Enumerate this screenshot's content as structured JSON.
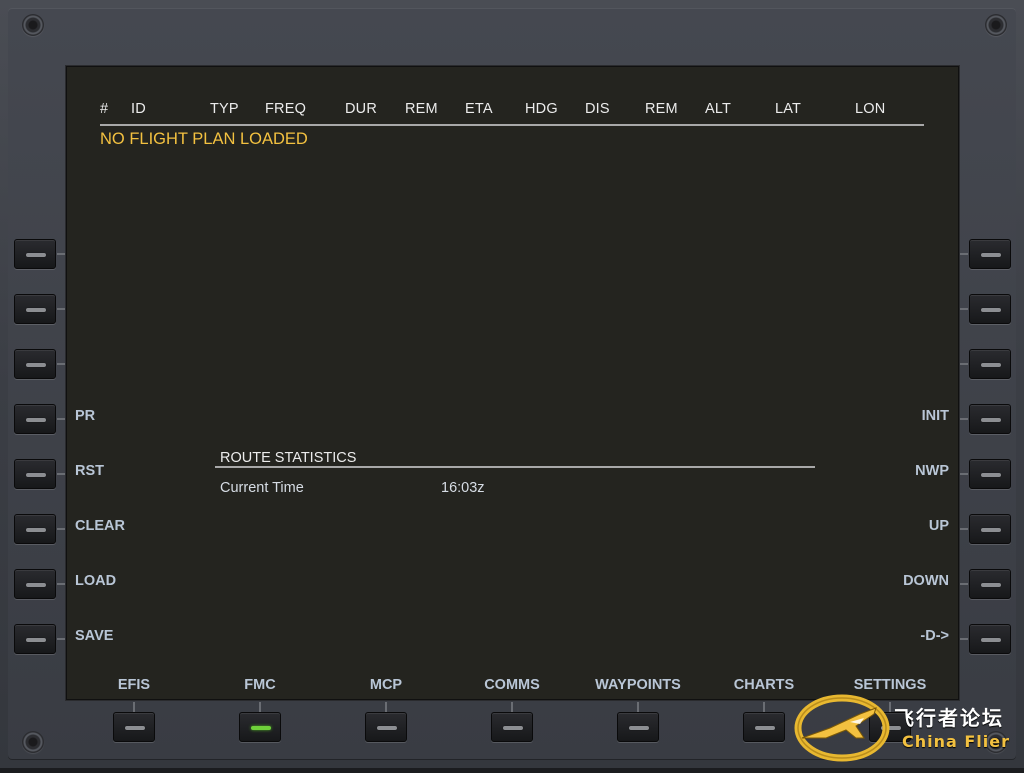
{
  "table_headers": [
    "#",
    "ID",
    "TYP",
    "FREQ",
    "DUR",
    "REM",
    "ETA",
    "HDG",
    "DIS",
    "REM",
    "ALT",
    "LAT",
    "LON"
  ],
  "flight_plan_status": "NO FLIGHT PLAN LOADED",
  "route_statistics": {
    "title": "ROUTE STATISTICS",
    "rows": [
      {
        "label": "Current Time",
        "value": "16:03z"
      }
    ]
  },
  "left_keys": [
    "",
    "",
    "",
    "PR",
    "RST",
    "CLEAR",
    "LOAD",
    "SAVE"
  ],
  "right_keys": [
    "",
    "",
    "",
    "INIT",
    "NWP",
    "UP",
    "DOWN",
    "-D->"
  ],
  "bottom_tabs": [
    {
      "label": "EFIS",
      "active": false
    },
    {
      "label": "FMC",
      "active": true
    },
    {
      "label": "MCP",
      "active": false
    },
    {
      "label": "COMMS",
      "active": false
    },
    {
      "label": "WAYPOINTS",
      "active": false
    },
    {
      "label": "CHARTS",
      "active": false
    },
    {
      "label": "SETTINGS",
      "active": false
    }
  ],
  "watermark": {
    "chinese_text": "飞行者论坛",
    "english_text": "China Flier"
  },
  "colors": {
    "screen_bg": "#24241f",
    "status_amber": "#f3c140",
    "label_blue_gray": "#b9c6d6",
    "active_led": "#6fd13a"
  }
}
